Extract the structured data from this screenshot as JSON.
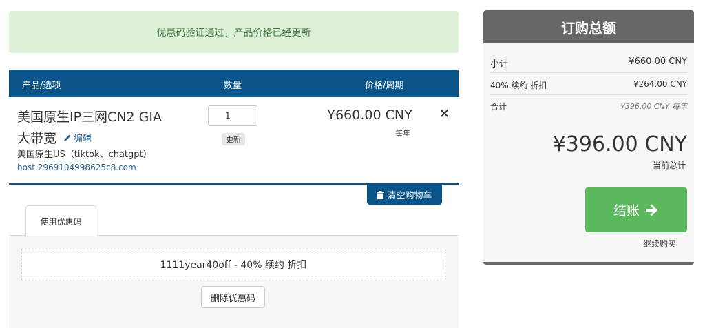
{
  "alert": {
    "message": "优惠码验证通过，产品价格已经更新"
  },
  "cart_header": {
    "col_product": "产品/选项",
    "col_qty": "数量",
    "col_price": "价格/周期"
  },
  "item": {
    "name_line1": "美国原生IP三网CN2 GIA",
    "name_line2": "大带宽",
    "edit_label": "编辑",
    "group": "美国原生US（tiktok、chatgpt）",
    "host": "host.2969104998625c8.com",
    "qty": "1",
    "update_label": "更新",
    "price": "¥660.00 CNY",
    "cycle": "每年",
    "remove_symbol": "×"
  },
  "clear_cart_label": "清空购物车",
  "promo": {
    "tab_label": "使用优惠码",
    "applied_text": "1111year40off - 40% 续约 折扣",
    "remove_label": "删除优惠码"
  },
  "summary": {
    "title": "订购总额",
    "subtotal_label": "小计",
    "subtotal_value": "¥660.00 CNY",
    "discount_label": "40% 续约 折扣",
    "discount_value": "¥264.00 CNY",
    "total_label": "合计",
    "total_value": "¥396.00 CNY 每年",
    "grand_total": "¥396.00 CNY",
    "grand_total_label": "当前总计",
    "checkout_label": "结账",
    "continue_label": "继续购买"
  },
  "colors": {
    "primary": "#0a5489",
    "success": "#5cb85c",
    "alert_bg": "#dff0d8",
    "alert_text": "#3c763d",
    "summary_head": "#666666"
  }
}
